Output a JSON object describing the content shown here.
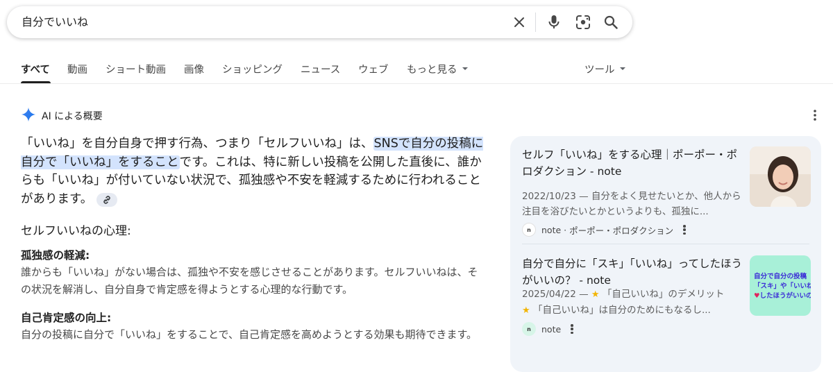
{
  "search": {
    "query": "自分でいいね"
  },
  "tabs": [
    {
      "label": "すべて"
    },
    {
      "label": "動画"
    },
    {
      "label": "ショート動画"
    },
    {
      "label": "画像"
    },
    {
      "label": "ショッピング"
    },
    {
      "label": "ニュース"
    },
    {
      "label": "ウェブ"
    },
    {
      "label": "もっと見る"
    }
  ],
  "tools_label": "ツール",
  "ai_overview": {
    "title": "AI による概要",
    "answer_part1": "「いいね」を自分自身で押す行為、つまり「セルフいいね」は、",
    "answer_highlight": "SNSで自分の投稿に自分で「いいね」をすること",
    "answer_part2": "です。これは、特に新しい投稿を公開した直後に、誰からも「いいね」が付いていない状況で、孤独感や不安を軽減するために行われることがあります。",
    "section_title": "セルフいいねの心理:",
    "points": [
      {
        "title": "孤独感の軽減:",
        "text": "誰からも「いいね」がない場合は、孤独や不安を感じさせることがあります。セルフいいねは、その状況を解消し、自分自身で肯定感を得ようとする心理的な行動です。"
      },
      {
        "title": "自己肯定感の向上:",
        "text": "自分の投稿に自分で「いいね」をすることで、自己肯定感を高めようとする効果も期待できます。"
      }
    ]
  },
  "sources": [
    {
      "title": "セルフ「いいね」をする心理｜ポーポー・ポロダクション - note",
      "snippet": "2022/10/23 — 自分をよく見せたいとか、他人から注目を浴びたいとかというよりも、孤独に...",
      "site": "note",
      "author": "ポーポー・ポロダクション"
    },
    {
      "title": "自分で自分に「スキ」「いいね」ってしたほうがいいの？ - note",
      "snippet_date": "2025/04/22 — ",
      "snippet_a": "「自己いいね」のデメリット",
      "snippet_b": "「自己いいね」は自分のためにもなるし...",
      "site": "note",
      "thumb_line1": "自分で自分の投稿",
      "thumb_line2": "「スキ」や「いいね",
      "thumb_line3": "したほうがいいの"
    }
  ],
  "colors": {
    "highlight": "#d3e3fd",
    "panel": "#f0f4f9",
    "gemini_blue": "#4285f4"
  }
}
